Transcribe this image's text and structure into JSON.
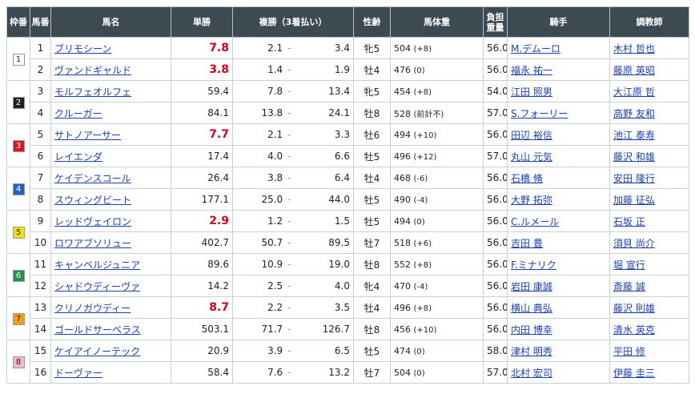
{
  "headers": {
    "waku": "枠番",
    "umaban": "馬番",
    "name": "馬名",
    "tansho": "単勝",
    "fukusho": "複勝（3着払い）",
    "age": "性齢",
    "weight": "馬体重",
    "kinryo_1": "負担",
    "kinryo_2": "重量",
    "jockey": "騎手",
    "trainer": "調教師"
  },
  "waku_colors": {
    "1": {
      "bg": "#ffffff",
      "fg": "#222222"
    },
    "2": {
      "bg": "#222222",
      "fg": "#ffffff"
    },
    "3": {
      "bg": "#e0141e",
      "fg": "#ffffff"
    },
    "4": {
      "bg": "#1e64c8",
      "fg": "#ffffff"
    },
    "5": {
      "bg": "#f5e10a",
      "fg": "#222222"
    },
    "6": {
      "bg": "#1e9646",
      "fg": "#ffffff"
    },
    "7": {
      "bg": "#f5a00a",
      "fg": "#222222"
    },
    "8": {
      "bg": "#f7b4cd",
      "fg": "#222222"
    }
  },
  "rows": [
    {
      "waku": "1",
      "num": "1",
      "name": "ブリモシーン",
      "odds": "7.8",
      "fav": true,
      "pl_lo": "2.1",
      "pl_hi": "3.4",
      "age": "牝5",
      "weight": "504",
      "diff": "(+8)",
      "kg": "56.0",
      "jockey": "M.デムーロ",
      "trainer": "木村 哲也"
    },
    {
      "waku": "1",
      "num": "2",
      "name": "ヴァンドギャルド",
      "odds": "3.8",
      "fav": true,
      "pl_lo": "1.4",
      "pl_hi": "1.9",
      "age": "牡4",
      "weight": "476",
      "diff": "(0)",
      "kg": "56.0",
      "jockey": "福永 祐一",
      "trainer": "藤原 英昭"
    },
    {
      "waku": "2",
      "num": "3",
      "name": "モルフェオルフェ",
      "odds": "59.4",
      "fav": false,
      "pl_lo": "7.8",
      "pl_hi": "13.4",
      "age": "牝5",
      "weight": "454",
      "diff": "(+8)",
      "kg": "54.0",
      "jockey": "江田 照男",
      "trainer": "大江原 哲"
    },
    {
      "waku": "2",
      "num": "4",
      "name": "クルーガー",
      "odds": "84.1",
      "fav": false,
      "pl_lo": "13.8",
      "pl_hi": "24.1",
      "age": "牡8",
      "weight": "528",
      "diff": "(前計不)",
      "kg": "57.0",
      "jockey": "S.フォーリー",
      "trainer": "高野 友和"
    },
    {
      "waku": "3",
      "num": "5",
      "name": "サトノアーサー",
      "odds": "7.7",
      "fav": true,
      "pl_lo": "2.1",
      "pl_hi": "3.3",
      "age": "牡6",
      "weight": "494",
      "diff": "(+10)",
      "kg": "56.0",
      "jockey": "田辺 裕信",
      "trainer": "池江 泰寿"
    },
    {
      "waku": "3",
      "num": "6",
      "name": "レイエンダ",
      "odds": "17.4",
      "fav": false,
      "pl_lo": "4.0",
      "pl_hi": "6.6",
      "age": "牡5",
      "weight": "496",
      "diff": "(+12)",
      "kg": "57.0",
      "jockey": "丸山 元気",
      "trainer": "藤沢 和雄"
    },
    {
      "waku": "4",
      "num": "7",
      "name": "ケイデンスコール",
      "odds": "26.4",
      "fav": false,
      "pl_lo": "3.8",
      "pl_hi": "6.4",
      "age": "牡4",
      "weight": "468",
      "diff": "(-6)",
      "kg": "56.0",
      "jockey": "石橋 脩",
      "trainer": "安田 隆行"
    },
    {
      "waku": "4",
      "num": "8",
      "name": "スウィングビート",
      "odds": "177.1",
      "fav": false,
      "pl_lo": "25.0",
      "pl_hi": "44.0",
      "age": "牡5",
      "weight": "490",
      "diff": "(-4)",
      "kg": "56.0",
      "jockey": "大野 拓弥",
      "trainer": "加藤 征弘"
    },
    {
      "waku": "5",
      "num": "9",
      "name": "レッドヴェイロン",
      "odds": "2.9",
      "fav": true,
      "pl_lo": "1.2",
      "pl_hi": "1.5",
      "age": "牡5",
      "weight": "494",
      "diff": "(0)",
      "kg": "56.0",
      "jockey": "C.ルメール",
      "trainer": "石坂 正"
    },
    {
      "waku": "5",
      "num": "10",
      "name": "ロワアブソリュー",
      "odds": "402.7",
      "fav": false,
      "pl_lo": "50.7",
      "pl_hi": "89.5",
      "age": "牡7",
      "weight": "518",
      "diff": "(+6)",
      "kg": "56.0",
      "jockey": "吉田 豊",
      "trainer": "須貝 尚介"
    },
    {
      "waku": "6",
      "num": "11",
      "name": "キャンベルジュニア",
      "odds": "89.6",
      "fav": false,
      "pl_lo": "10.9",
      "pl_hi": "19.0",
      "age": "牡8",
      "weight": "552",
      "diff": "(+8)",
      "kg": "56.0",
      "jockey": "F.ミナリク",
      "trainer": "堀 宣行"
    },
    {
      "waku": "6",
      "num": "12",
      "name": "シャドウディーヴァ",
      "odds": "14.2",
      "fav": false,
      "pl_lo": "2.5",
      "pl_hi": "4.0",
      "age": "牝4",
      "weight": "470",
      "diff": "(-4)",
      "kg": "56.0",
      "jockey": "岩田 康誠",
      "trainer": "斎藤 誠"
    },
    {
      "waku": "7",
      "num": "13",
      "name": "クリノガウディー",
      "odds": "8.7",
      "fav": true,
      "pl_lo": "2.2",
      "pl_hi": "3.5",
      "age": "牡4",
      "weight": "496",
      "diff": "(+8)",
      "kg": "56.0",
      "jockey": "横山 典弘",
      "trainer": "藤沢 則雄"
    },
    {
      "waku": "7",
      "num": "14",
      "name": "ゴールドサーベラス",
      "odds": "503.1",
      "fav": false,
      "pl_lo": "71.7",
      "pl_hi": "126.7",
      "age": "牡8",
      "weight": "456",
      "diff": "(+10)",
      "kg": "56.0",
      "jockey": "内田 博幸",
      "trainer": "清水 英克"
    },
    {
      "waku": "8",
      "num": "15",
      "name": "ケイアイノーテック",
      "odds": "20.9",
      "fav": false,
      "pl_lo": "3.9",
      "pl_hi": "6.5",
      "age": "牡5",
      "weight": "474",
      "diff": "(0)",
      "kg": "58.0",
      "jockey": "津村 明秀",
      "trainer": "平田 修"
    },
    {
      "waku": "8",
      "num": "16",
      "name": "ドーヴァー",
      "odds": "58.4",
      "fav": false,
      "pl_lo": "7.6",
      "pl_hi": "13.2",
      "age": "牡7",
      "weight": "504",
      "diff": "(0)",
      "kg": "57.0",
      "jockey": "北村 宏司",
      "trainer": "伊藤 圭三"
    }
  ]
}
